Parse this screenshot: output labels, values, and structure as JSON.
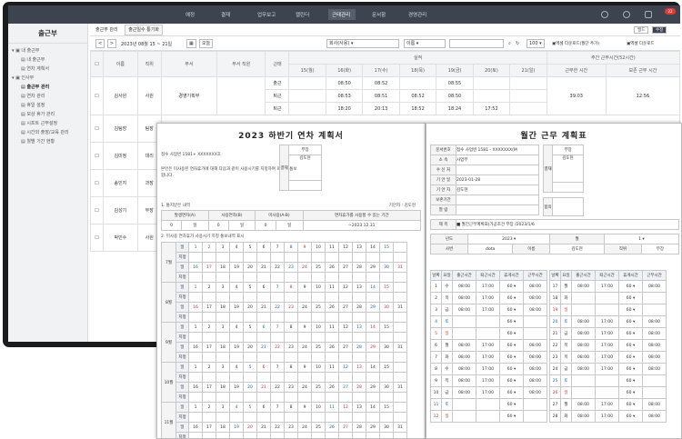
{
  "nav": [
    "예정",
    "결재",
    "업무보고",
    "캘린더",
    "근태관리",
    "문서함",
    "경영관리"
  ],
  "nav_active_index": 4,
  "badge": "22",
  "sidebar": {
    "title": "출근부",
    "items": [
      "내 출근부",
      "내 출근부",
      "연차 계획서",
      "인사부",
      "출근부 관리",
      "연차 관리",
      "휴일 설정",
      "보상 휴가 관리",
      "시프트 근무설정",
      "시간외 출장/교육 관리",
      "월별 기간 현황"
    ]
  },
  "tabs": {
    "items": [
      "출근부 관리",
      "출근일수 통기화"
    ],
    "btn_edit": "필드",
    "btn_save": "수정"
  },
  "toolbar": {
    "prev": "<",
    "next": ">",
    "period": "2023년 08월 15 ~ 21일",
    "today": "오늘",
    "select_dept": "회사(사용)",
    "select_type": "이름",
    "page_size": "100",
    "label1": "엑셀 다운로드(월단 추가)",
    "label2": "엑셀 다운로드"
  },
  "table": {
    "headers": [
      "이름",
      "직위",
      "부서",
      "부서 직원",
      "근태",
      "15(월)",
      "16(화)",
      "17(수)",
      "18(목)",
      "19(금)",
      "20(토)",
      "21(일)",
      "근무한 시간",
      "보존 근무 시간"
    ],
    "group_header": "실적",
    "group_header2": "주간 근무시간(52시간)",
    "row_labels": [
      "출근",
      "퇴근",
      "출근",
      "퇴근"
    ],
    "rows": [
      {
        "name": "",
        "rank": "",
        "dept": "",
        "times": [
          [
            "",
            "08:50",
            "08:52",
            "",
            "08:55",
            ""
          ],
          [
            "",
            "08:53",
            "08:51",
            "08:52",
            "08:50",
            ""
          ],
          [
            "",
            "18:20",
            "20:13",
            "18:52",
            "18:24",
            "17:52"
          ]
        ],
        "total": "39:03",
        "reserve": "12:56"
      },
      {
        "name": "김사원",
        "rank": "사원",
        "dept": "경영기획부",
        "times": [],
        "total": "",
        "reserve": ""
      },
      {
        "name": "김팀장",
        "rank": "팀장",
        "dept": "",
        "times": [],
        "total": "",
        "reserve": ""
      },
      {
        "name": "김미정",
        "rank": "대리",
        "dept": "",
        "times": [],
        "total": "",
        "reserve": ""
      },
      {
        "name": "송민지",
        "rank": "과장",
        "dept": "",
        "times": [],
        "total": "",
        "reserve": ""
      },
      {
        "name": "김성기",
        "rank": "부장",
        "dept": "",
        "times": [],
        "total": "",
        "reserve": ""
      },
      {
        "name": "박민수",
        "rank": "사원",
        "dept": "",
        "times": [],
        "total": "",
        "reserve": ""
      }
    ]
  },
  "doc1": {
    "title": "2023 하반기 연차 계획서",
    "company": "접수 사업번 1581+ XXXXXXX호",
    "approval_label": "결재",
    "approval_role": "부장",
    "approval_name": "김도현",
    "desc": "본인은 미사용된 연차휴가에 대해 다음과 같이 사용시기를 지정하여 회사에 통보합니다.",
    "sec1": "1. 통지받은 내역",
    "sec1_right": "기안자 : 김도현",
    "sec1_headers": [
      "발생연차(A)",
      "사용연차(B)",
      "미사용(A-B)",
      "연차휴가를 사용할 수 있는 기간"
    ],
    "sec1_values": [
      "0",
      "일",
      "0",
      "일",
      "0",
      "일",
      "~2023.12.31"
    ],
    "sec2": "2. 미사용 연차휴가 사용시기 지정 통보내역 표시",
    "months": [
      "7월",
      "8월",
      "9월",
      "10월",
      "11월"
    ],
    "row_labels": [
      "일",
      "지정"
    ],
    "days_first": [
      "1",
      "2",
      "3",
      "4",
      "5",
      "6",
      "7",
      "8",
      "9",
      "10",
      "11",
      "12",
      "13",
      "14",
      "15"
    ],
    "days_second": [
      "16",
      "17",
      "18",
      "19",
      "20",
      "21",
      "22",
      "23",
      "24",
      "25",
      "26",
      "27",
      "28",
      "29",
      "30",
      "31"
    ]
  },
  "doc2": {
    "title": "월간 근무 계획표",
    "fields": [
      {
        "label": "문서번호",
        "value": "접수 사업번 1581 - XXXXXXX(M"
      },
      {
        "label": "소 속",
        "value": "사업부"
      },
      {
        "label": "수 신 처",
        "value": ""
      },
      {
        "label": "기 안 일",
        "value": "2023-01-28"
      },
      {
        "label": "기 안 자",
        "value": "김도현"
      },
      {
        "label": "보존기간",
        "value": ""
      },
      {
        "label": "열 람",
        "value": ""
      },
      {
        "label": "제 목",
        "value": "■ 월간근무계획표(가공조건 부장 /2023/1/6"
      }
    ],
    "approval_label": "결재",
    "approval_role": "부장",
    "approval_name": "김도현",
    "approval_label2": "합의",
    "year_label": "년도",
    "year": "2023",
    "month_label": "월",
    "month": "1",
    "team_label": "사번",
    "team": "dota",
    "name_label": "이름",
    "name": "김도현",
    "rank_label": "직위",
    "rank": "부장",
    "dept_label": "소속",
    "dept": "사업부",
    "col_headers": [
      "날짜",
      "요일",
      "출근시간",
      "퇴근시간",
      "휴게시간",
      "근무시간"
    ],
    "left_rows": [
      {
        "d": "1",
        "w": "수",
        "in": "08:00",
        "out": "17:00",
        "rest": "60",
        "work": "08:00"
      },
      {
        "d": "2",
        "w": "목",
        "in": "08:00",
        "out": "17:00",
        "rest": "60",
        "work": "08:00"
      },
      {
        "d": "3",
        "w": "금",
        "in": "08:00",
        "out": "17:00",
        "rest": "60",
        "work": "08:00"
      },
      {
        "d": "4",
        "w": "토",
        "in": "",
        "out": "",
        "rest": "60",
        "work": ""
      },
      {
        "d": "5",
        "w": "일",
        "in": "",
        "out": "",
        "rest": "60",
        "work": ""
      },
      {
        "d": "6",
        "w": "월",
        "in": "08:00",
        "out": "17:00",
        "rest": "60",
        "work": "08:00"
      },
      {
        "d": "7",
        "w": "화",
        "in": "08:00",
        "out": "17:00",
        "rest": "60",
        "work": "08:00"
      },
      {
        "d": "8",
        "w": "수",
        "in": "08:00",
        "out": "17:00",
        "rest": "60",
        "work": "08:00"
      },
      {
        "d": "9",
        "w": "목",
        "in": "08:00",
        "out": "17:00",
        "rest": "60",
        "work": "08:00"
      },
      {
        "d": "10",
        "w": "금",
        "in": "08:00",
        "out": "17:00",
        "rest": "60",
        "work": "08:00"
      },
      {
        "d": "11",
        "w": "토",
        "in": "",
        "out": "",
        "rest": "60",
        "work": ""
      },
      {
        "d": "12",
        "w": "일",
        "in": "",
        "out": "",
        "rest": "60",
        "work": ""
      }
    ],
    "right_rows": [
      {
        "d": "17",
        "w": "월",
        "in": "08:00",
        "out": "17:00",
        "rest": "60",
        "work": "08:00"
      },
      {
        "d": "18",
        "w": "화",
        "in": "",
        "out": "",
        "rest": "60",
        "work": ""
      },
      {
        "d": "19",
        "w": "일",
        "in": "",
        "out": "",
        "rest": "60",
        "work": ""
      },
      {
        "d": "20",
        "w": "토",
        "in": "08:00",
        "out": "17:00",
        "rest": "60",
        "work": "08:00"
      },
      {
        "d": "21",
        "w": "금",
        "in": "08:00",
        "out": "17:00",
        "rest": "60",
        "work": "08:00"
      },
      {
        "d": "22",
        "w": "목",
        "in": "08:00",
        "out": "17:00",
        "rest": "60",
        "work": "08:00"
      },
      {
        "d": "23",
        "w": "목",
        "in": "08:00",
        "out": "17:00",
        "rest": "60",
        "work": "08:00"
      },
      {
        "d": "24",
        "w": "금",
        "in": "08:00",
        "out": "17:00",
        "rest": "60",
        "work": "08:00"
      },
      {
        "d": "25",
        "w": "토",
        "in": "",
        "out": "",
        "rest": "60",
        "work": ""
      },
      {
        "d": "26",
        "w": "일",
        "in": "",
        "out": "",
        "rest": "60",
        "work": ""
      },
      {
        "d": "27",
        "w": "월",
        "in": "08:00",
        "out": "17:00",
        "rest": "60",
        "work": "08:00"
      },
      {
        "d": "28",
        "w": "화",
        "in": "08:00",
        "out": "17:00",
        "rest": "60",
        "work": "08:00"
      }
    ]
  },
  "colors": {
    "nav_bg": "#3d4450",
    "accent_red": "#d32f2f",
    "accent_blue": "#1565c0",
    "sidebar_bg": "#f1f2f4"
  }
}
